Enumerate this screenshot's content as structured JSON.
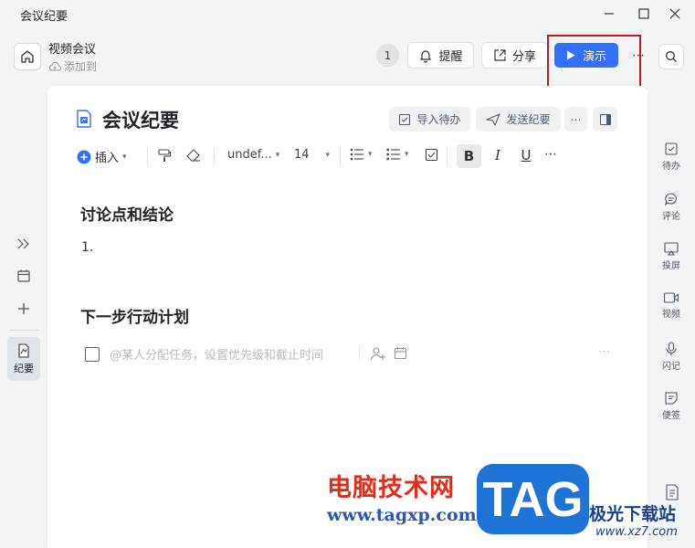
{
  "window": {
    "title": "会议纪要"
  },
  "header": {
    "meeting_title": "视频会议",
    "add_to_label": "添加到",
    "participant_count": "1",
    "remind_label": "提醒",
    "share_label": "分享",
    "present_label": "演示"
  },
  "document": {
    "title": "会议纪要",
    "import_todo_label": "导入待办",
    "send_summary_label": "发送纪要",
    "toolbar": {
      "insert_label": "插入",
      "font_name": "undef...",
      "font_size": "14",
      "bold": "B",
      "italic": "I",
      "underline": "U"
    },
    "section1_heading": "讨论点和结论",
    "list_item_number": "1.",
    "section2_heading": "下一步行动计划",
    "task_placeholder": "@某人分配任务，设置优先级和截止时间"
  },
  "left_rail": {
    "summary_label": "纪要"
  },
  "right_rail": {
    "items": [
      {
        "label": "待办"
      },
      {
        "label": "评论"
      },
      {
        "label": "投屏"
      },
      {
        "label": "视频"
      },
      {
        "label": "闪记"
      },
      {
        "label": "便签"
      }
    ]
  },
  "watermark": {
    "site_name": "电脑技术网",
    "site_url": "www.tagxp.com",
    "logo_text": "TAG",
    "partner_name": "极光下载站",
    "partner_url": "www.xz7.com"
  },
  "colors": {
    "accent": "#3370ff",
    "highlight": "#c8161d"
  }
}
